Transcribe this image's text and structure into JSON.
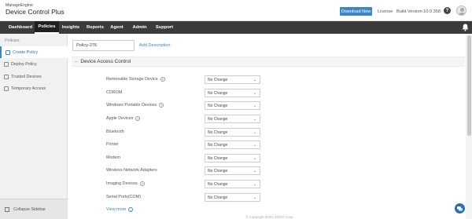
{
  "header": {
    "brand_top": "ManageEngine",
    "brand_name": "Device Control Plus",
    "download_label": "Download Now",
    "license_label": "License",
    "build_label": "Build Version:10.0.358",
    "help_glyph": "?"
  },
  "nav": {
    "tabs": [
      {
        "label": "Dashboard"
      },
      {
        "label": "Policies",
        "active": true
      },
      {
        "label": "Insights"
      },
      {
        "label": "Reports"
      },
      {
        "label": "Agent"
      },
      {
        "label": "Admin"
      },
      {
        "label": "Support"
      }
    ],
    "bell_icon": "bell-icon"
  },
  "sidebar": {
    "title": "Policies",
    "items": [
      {
        "label": "Create Policy",
        "icon": "create-policy-icon",
        "active": true
      },
      {
        "label": "Deploy Policy",
        "icon": "deploy-policy-icon"
      },
      {
        "label": "Trusted Devices",
        "icon": "trusted-devices-icon"
      },
      {
        "label": "Temporary Access",
        "icon": "temporary-access-icon"
      }
    ],
    "collapse_label": "Collapse Sidebar"
  },
  "main": {
    "policy_name_value": "Policy-276",
    "add_description": "Add Description",
    "section_title": "Device Access Control",
    "rows": [
      {
        "label": "Removable Storage Device",
        "help": true,
        "value": "No Change"
      },
      {
        "label": "CDROM",
        "help": false,
        "value": "No Change"
      },
      {
        "label": "Windows Portable Devices",
        "help": true,
        "value": "No Change"
      },
      {
        "label": "Apple Devices",
        "help": true,
        "value": "No Change"
      },
      {
        "label": "Bluetooth",
        "help": false,
        "value": "No Change"
      },
      {
        "label": "Printer",
        "help": false,
        "value": "No Change"
      },
      {
        "label": "Modem",
        "help": false,
        "value": "No Change"
      },
      {
        "label": "Wireless Network Adapters",
        "help": false,
        "value": "No Change"
      },
      {
        "label": "Imaging Devices",
        "help": true,
        "value": "No Change"
      },
      {
        "label": "Serial Ports(COM)",
        "help": false,
        "value": "No Change"
      }
    ],
    "view_more": "View more",
    "footer": "© Copyright 2020, ZOHO Corp."
  },
  "colors": {
    "accent": "#3a87c8",
    "nav_bg": "#3b3b3b",
    "sidebar_bg": "#f1f1f1"
  }
}
